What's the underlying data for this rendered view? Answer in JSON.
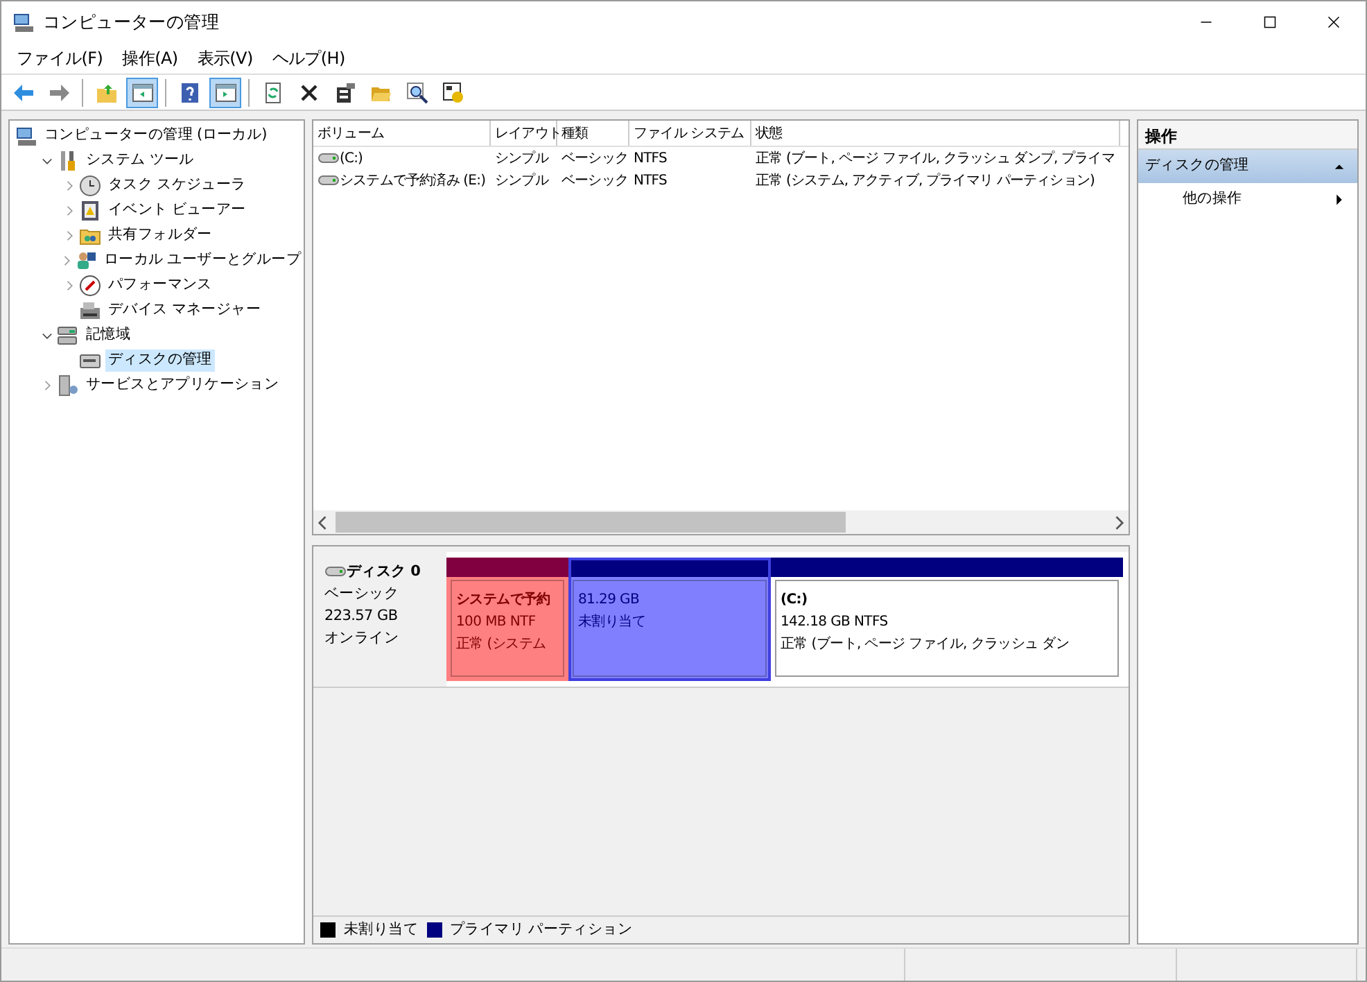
{
  "window": {
    "title": "コンピューターの管理"
  },
  "menu": [
    "ファイル(F)",
    "操作(A)",
    "表示(V)",
    "ヘルプ(H)"
  ],
  "toolbar": [
    [
      {
        "on": false
      },
      {
        "on": false
      }
    ],
    [
      {
        "on": false
      },
      {
        "on": true
      }
    ],
    [
      {
        "on": false
      },
      {
        "on": true
      }
    ],
    [
      {
        "on": false
      },
      {
        "on": false
      },
      {
        "on": false
      },
      {
        "on": false
      },
      {
        "on": false
      },
      {
        "on": false
      }
    ]
  ],
  "tree": [
    {
      "label": "コンピューターの管理 (ローカル)",
      "selected": false,
      "children": [
        {
          "label": "システム ツール",
          "expanded": true,
          "selected": false,
          "children": [
            {
              "label": "タスク スケジューラ",
              "expanded": false,
              "selected": false
            },
            {
              "label": "イベント ビューアー",
              "expanded": false,
              "selected": false
            },
            {
              "label": "共有フォルダー",
              "expanded": false,
              "selected": false
            },
            {
              "label": "ローカル ユーザーとグループ",
              "expanded": false,
              "selected": false
            },
            {
              "label": "パフォーマンス",
              "expanded": false,
              "selected": false
            },
            {
              "label": "デバイス マネージャー",
              "selected": false
            }
          ]
        },
        {
          "label": "記憶域",
          "expanded": true,
          "selected": false,
          "children": [
            {
              "label": "ディスクの管理",
              "selected": true
            }
          ]
        },
        {
          "label": "サービスとアプリケーション",
          "expanded": false,
          "selected": false
        }
      ]
    }
  ],
  "volumes": {
    "columns": [
      "ボリューム",
      "レイアウト",
      "種類",
      "ファイル システム",
      "状態"
    ],
    "rows": [
      [
        "(C:)",
        "シンプル",
        "ベーシック",
        "NTFS",
        "正常 (ブート, ページ ファイル, クラッシュ ダンプ, プライマ"
      ],
      [
        "システムで予約済み (E:)",
        "シンプル",
        "ベーシック",
        "NTFS",
        "正常 (システム, アクティブ, プライマリ パーティション)"
      ]
    ]
  },
  "disks": [
    {
      "name": "ディスク 0",
      "type": "ベーシック",
      "size": "223.57 GB",
      "status": "オンライン",
      "partitions": [
        {
          "kind": "marked",
          "color": "#800040",
          "lines": [
            "システムで予約",
            "100 MB NTF",
            "正常 (システム"
          ]
        },
        {
          "kind": "selected",
          "color": "#000080",
          "lines": [
            "81.29 GB",
            "未割り当て"
          ]
        },
        {
          "kind": "normal",
          "color": "#000080",
          "lines": [
            "(C:)",
            "142.18 GB NTFS",
            "正常 (ブート, ページ ファイル, クラッシュ ダン"
          ]
        }
      ]
    }
  ],
  "legend": [
    {
      "label": "未割り当て",
      "color": "#000000"
    },
    {
      "label": "プライマリ パーティション",
      "color": "#000080"
    }
  ],
  "actions": {
    "title": "操作",
    "group": "ディスクの管理",
    "expanded": true,
    "items": [
      "他の操作"
    ]
  }
}
